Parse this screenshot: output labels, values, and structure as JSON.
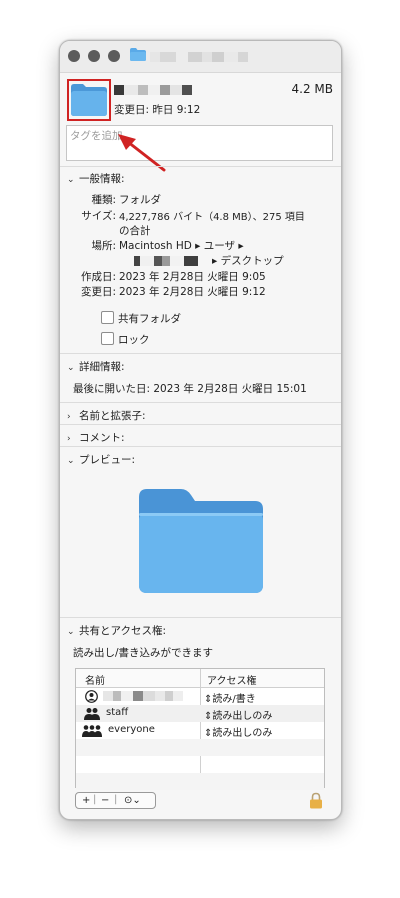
{
  "header": {
    "size": "4.2 MB",
    "modified": "変更日: 昨日 9:12",
    "tag_placeholder": "タグを追加"
  },
  "general": {
    "title": "一般情報:",
    "kind_label": "種類:",
    "kind_value": "フォルダ",
    "size_label": "サイズ:",
    "size_value_line1": "4,227,786 バイト（4.8 MB）、275 項目",
    "size_value_line2": "の合計",
    "where_label": "場所:",
    "where_line1": "Macintosh HD ▸ ユーザ ▸",
    "where_line2": "▸ デスクトップ",
    "created_label": "作成日:",
    "created_value": "2023 年 2月28日 火曜日 9:05",
    "modified_label": "変更日:",
    "modified_value": "2023 年 2月28日 火曜日 9:12",
    "shared_folder": "共有フォルダ",
    "locked": "ロック"
  },
  "more_info": {
    "title": "詳細情報:",
    "last_opened": "最後に開いた日: 2023 年 2月28日 火曜日 15:01"
  },
  "sections": {
    "name_ext": "名前と拡張子:",
    "comments": "コメント:",
    "preview": "プレビュー:",
    "sharing": "共有とアクセス権:"
  },
  "sharing": {
    "summary": "読み出し/書き込みができます",
    "col_name": "名前",
    "col_access": "アクセス権",
    "rows": [
      {
        "name": "",
        "access": "読み/書き",
        "icon": "user-circle-icon"
      },
      {
        "name": "staff",
        "access": "読み出しのみ",
        "icon": "group-icon"
      },
      {
        "name": "everyone",
        "access": "読み出しのみ",
        "icon": "everyone-icon"
      }
    ],
    "add_btn": "+",
    "remove_btn": "−",
    "action_btn": "⊙⌄"
  },
  "colors": {
    "folder": "#5aaae8",
    "highlight": "#d02323"
  }
}
